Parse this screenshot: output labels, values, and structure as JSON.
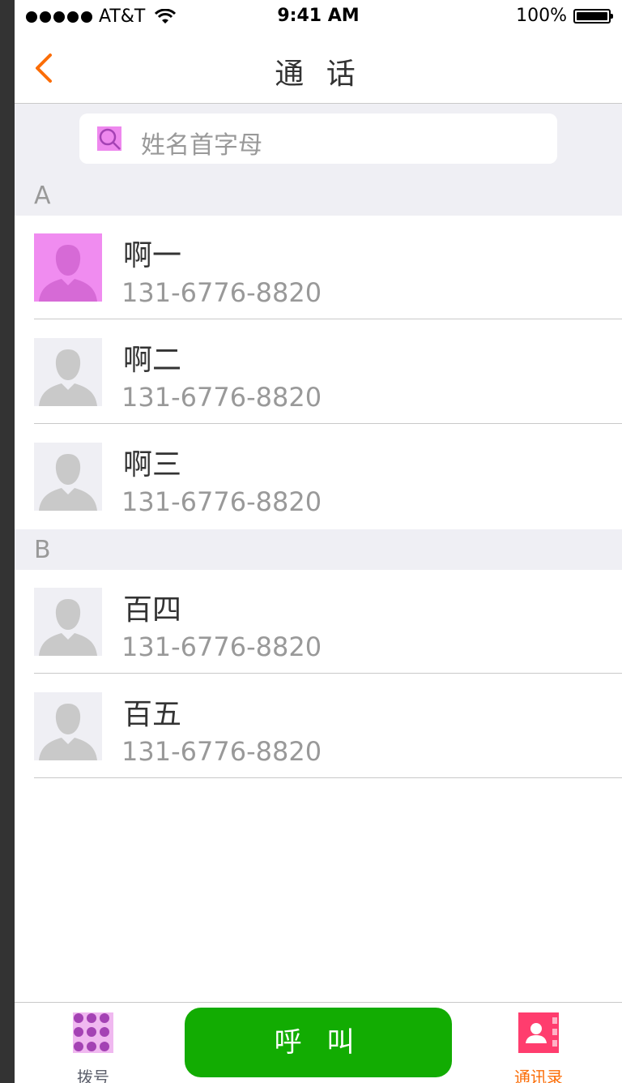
{
  "status_bar": {
    "carrier": "AT&T",
    "time": "9:41 AM",
    "battery": "100%"
  },
  "nav": {
    "title": "通 话"
  },
  "search": {
    "placeholder": "姓名首字母"
  },
  "sections": [
    {
      "letter": "A",
      "contacts": [
        {
          "name": "啊一",
          "phone": "131-6776-8820"
        },
        {
          "name": "啊二",
          "phone": "131-6776-8820"
        },
        {
          "name": "啊三",
          "phone": "131-6776-8820"
        }
      ]
    },
    {
      "letter": "B",
      "contacts": [
        {
          "name": "百四",
          "phone": "131-6776-8820"
        },
        {
          "name": "百五",
          "phone": "131-6776-8820"
        }
      ]
    }
  ],
  "bottom_bar": {
    "dial_label": "拨号",
    "call_label": "呼 叫",
    "contacts_label": "通讯录"
  },
  "colors": {
    "accent_orange": "#fb6d07",
    "call_green": "#12ac02",
    "background_gray": "#efeff4",
    "divider": "#c9c9c9",
    "name_text": "#333333",
    "secondary_text": "#999999",
    "dial_label": "#5e616d"
  }
}
